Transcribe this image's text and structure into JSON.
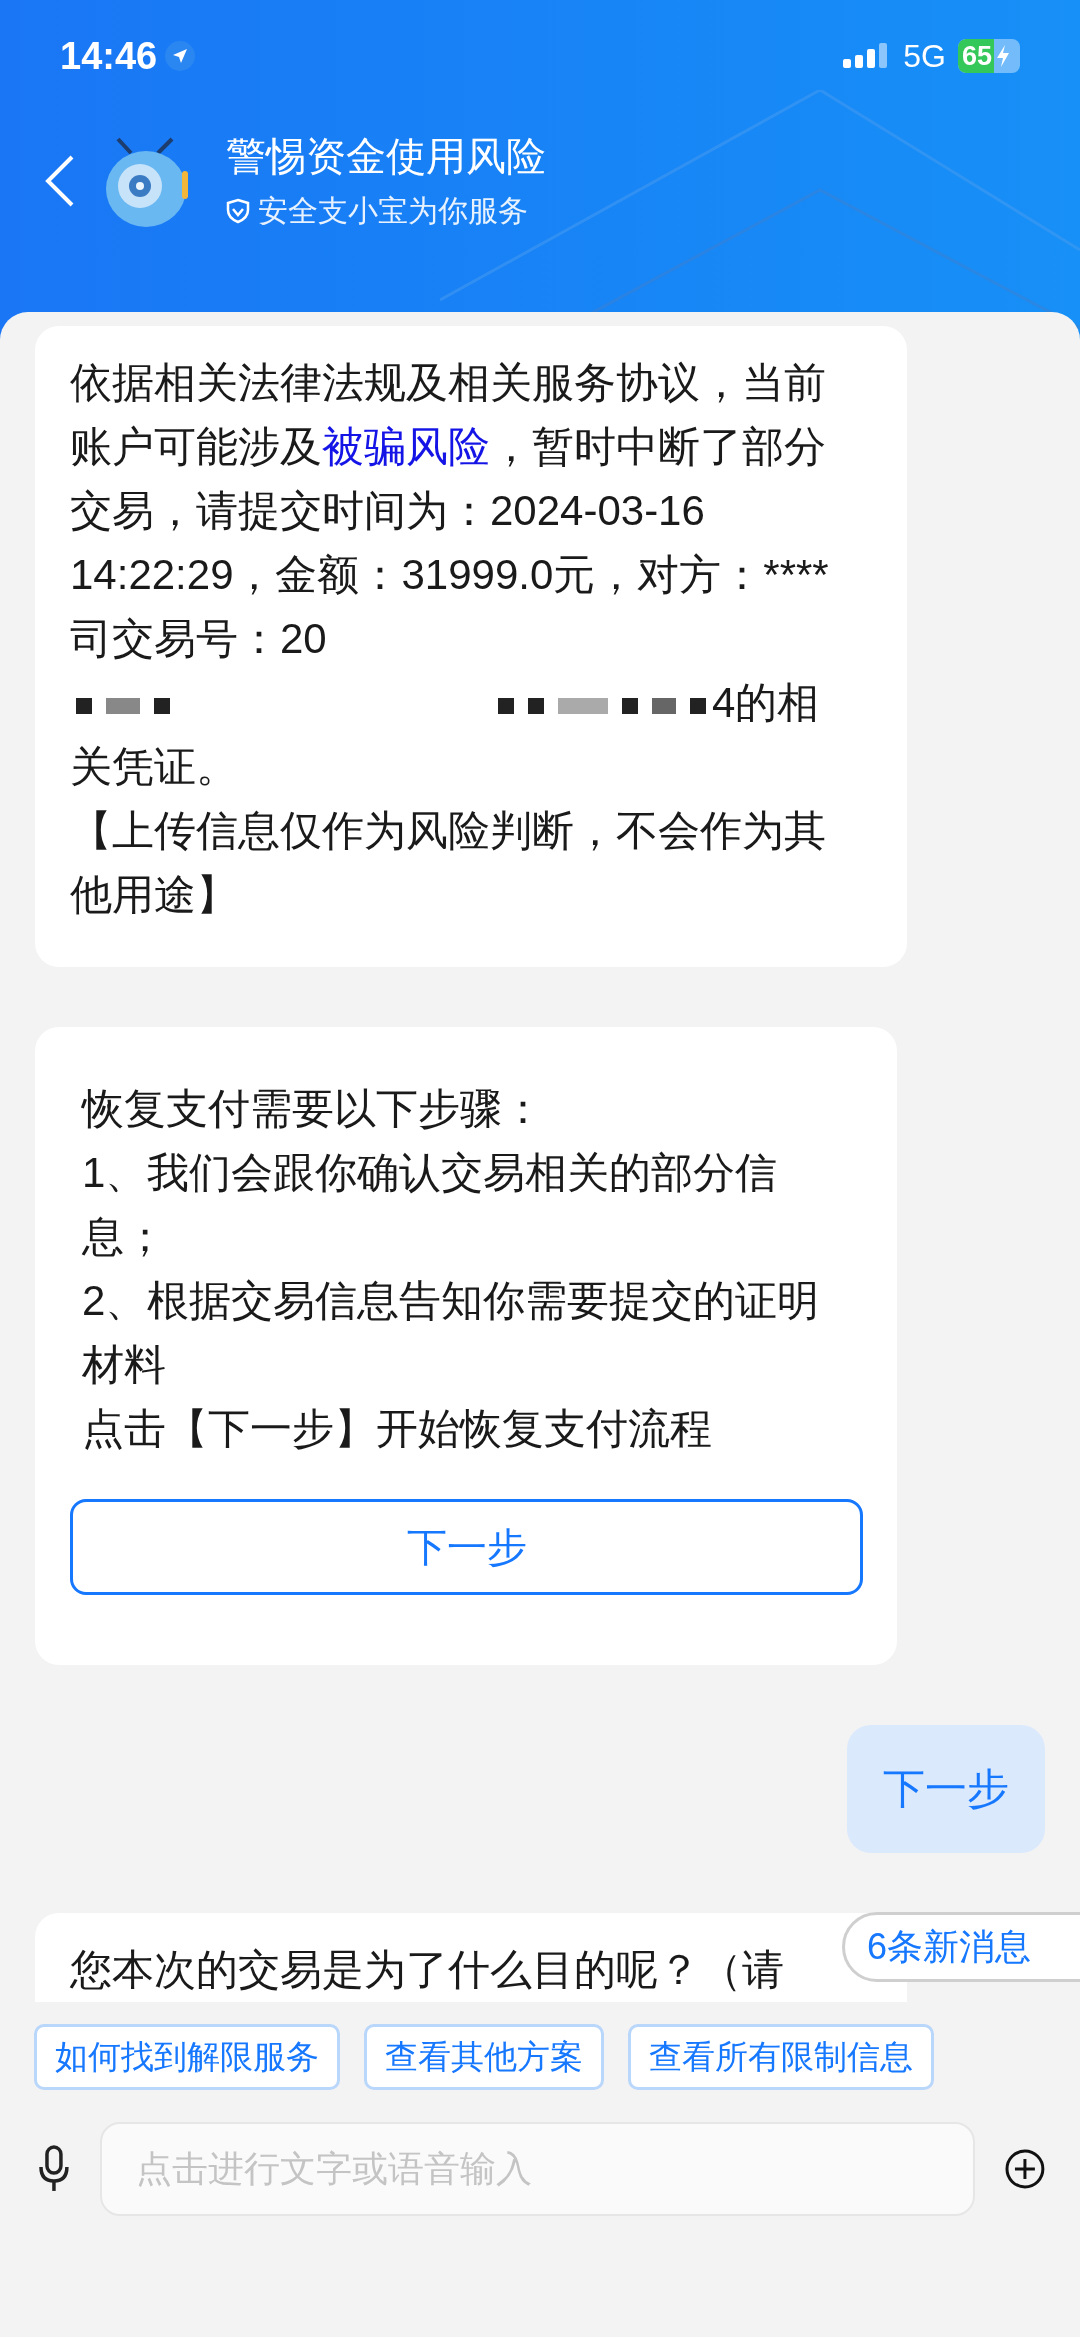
{
  "status_bar": {
    "time": "14:46",
    "network": "5G",
    "battery": "65"
  },
  "header": {
    "title": "警惕资金使用风险",
    "subtitle": "安全支小宝为你服务"
  },
  "messages": [
    {
      "outgoing": false,
      "kind": "text",
      "paragraphs": [
        [
          {
            "kind": "text",
            "text": "依据相关法律法规及相关服务协议，当前账户可能涉及"
          },
          {
            "kind": "link",
            "text": "被骗风险"
          },
          {
            "kind": "text",
            "text": "，暂时中断了部分交易，请提交时间为：2024-03-16 14:22:29，金额：31999.0元，对方：****司交易号：20"
          },
          {
            "kind": "redacted"
          },
          {
            "kind": "text",
            "text": "4的相关凭证。"
          }
        ],
        [
          {
            "kind": "text",
            "text": "【上传信息仅作为风险判断，不会作为其他用途】"
          }
        ]
      ]
    },
    {
      "outgoing": false,
      "kind": "action",
      "lines": [
        "恢复支付需要以下步骤：",
        "1、我们会跟你确认交易相关的部分信息；",
        "2、根据交易信息告知你需要提交的证明材料",
        "点击【下一步】开始恢复支付流程"
      ],
      "button": "下一步"
    },
    {
      "outgoing": true,
      "kind": "text",
      "paragraphs": [
        [
          {
            "kind": "text",
            "text": "下一步"
          }
        ]
      ]
    },
    {
      "outgoing": false,
      "kind": "text",
      "paragraphs": [
        [
          {
            "kind": "text",
            "text": "您本次的交易是为了什么目的呢？（请"
          }
        ]
      ]
    }
  ],
  "new_messages": "6条新消息",
  "quick_replies": [
    "如何找到解限服务",
    "查看其他方案",
    "查看所有限制信息"
  ],
  "input": {
    "placeholder": "点击进行文字或语音输入"
  }
}
